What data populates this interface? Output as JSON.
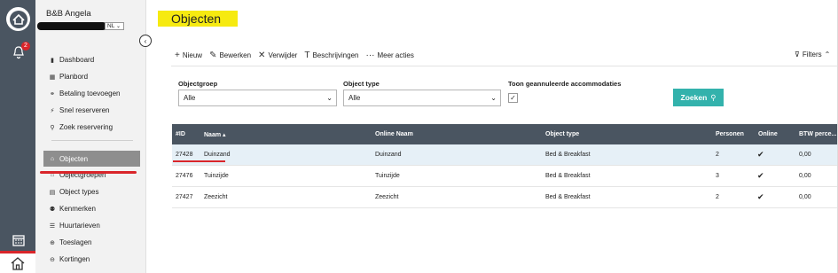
{
  "app": {
    "company": "B&B Angela",
    "language": "NL",
    "notifications_count": "2"
  },
  "sidebar": {
    "items": [
      {
        "label": "Dashboard",
        "icon": "chart-icon"
      },
      {
        "label": "Planbord",
        "icon": "board-icon"
      },
      {
        "label": "Betaling toevoegen",
        "icon": "payment-icon"
      },
      {
        "label": "Snel reserveren",
        "icon": "bolt-icon"
      },
      {
        "label": "Zoek reservering",
        "icon": "search-icon"
      }
    ],
    "items2": [
      {
        "label": "Objecten",
        "icon": "home-icon",
        "active": true
      },
      {
        "label": "Objectgroepen",
        "icon": "group-icon"
      },
      {
        "label": "Object types",
        "icon": "types-icon"
      },
      {
        "label": "Kenmerken",
        "icon": "features-icon"
      },
      {
        "label": "Huurtarieven",
        "icon": "rates-icon"
      },
      {
        "label": "Toeslagen",
        "icon": "plus-circle-icon"
      },
      {
        "label": "Kortingen",
        "icon": "minus-circle-icon"
      }
    ]
  },
  "page": {
    "title": "Objecten"
  },
  "toolbar": {
    "new": "Nieuw",
    "edit": "Bewerken",
    "delete": "Verwijder",
    "descriptions": "Beschrijvingen",
    "more": "Meer acties",
    "filters": "Filters"
  },
  "filters": {
    "objectgroep_label": "Objectgroep",
    "objectgroep_value": "Alle",
    "objecttype_label": "Object type",
    "objecttype_value": "Alle",
    "cancelled_label": "Toon geannuleerde accommodaties",
    "search_button": "Zoeken"
  },
  "table": {
    "columns": [
      "#ID",
      "Naam ▴",
      "Online Naam",
      "Object type",
      "Personen",
      "Online",
      "BTW perce..."
    ],
    "rows": [
      {
        "id": "27428",
        "name": "Duinzand",
        "online_name": "Duinzand",
        "type": "Bed & Breakfast",
        "persons": "2",
        "online": "✔",
        "vat": "0,00"
      },
      {
        "id": "27476",
        "name": "Tuinzijde",
        "online_name": "Tuinzijde",
        "type": "Bed & Breakfast",
        "persons": "3",
        "online": "✔",
        "vat": "0,00"
      },
      {
        "id": "27427",
        "name": "Zeezicht",
        "online_name": "Zeezicht",
        "type": "Bed & Breakfast",
        "persons": "2",
        "online": "✔",
        "vat": "0,00"
      }
    ]
  },
  "colors": {
    "rail": "#4a5561",
    "accent": "#33b2ac",
    "title_highlight": "#f6ea10",
    "annotation_red": "#d9252a"
  }
}
